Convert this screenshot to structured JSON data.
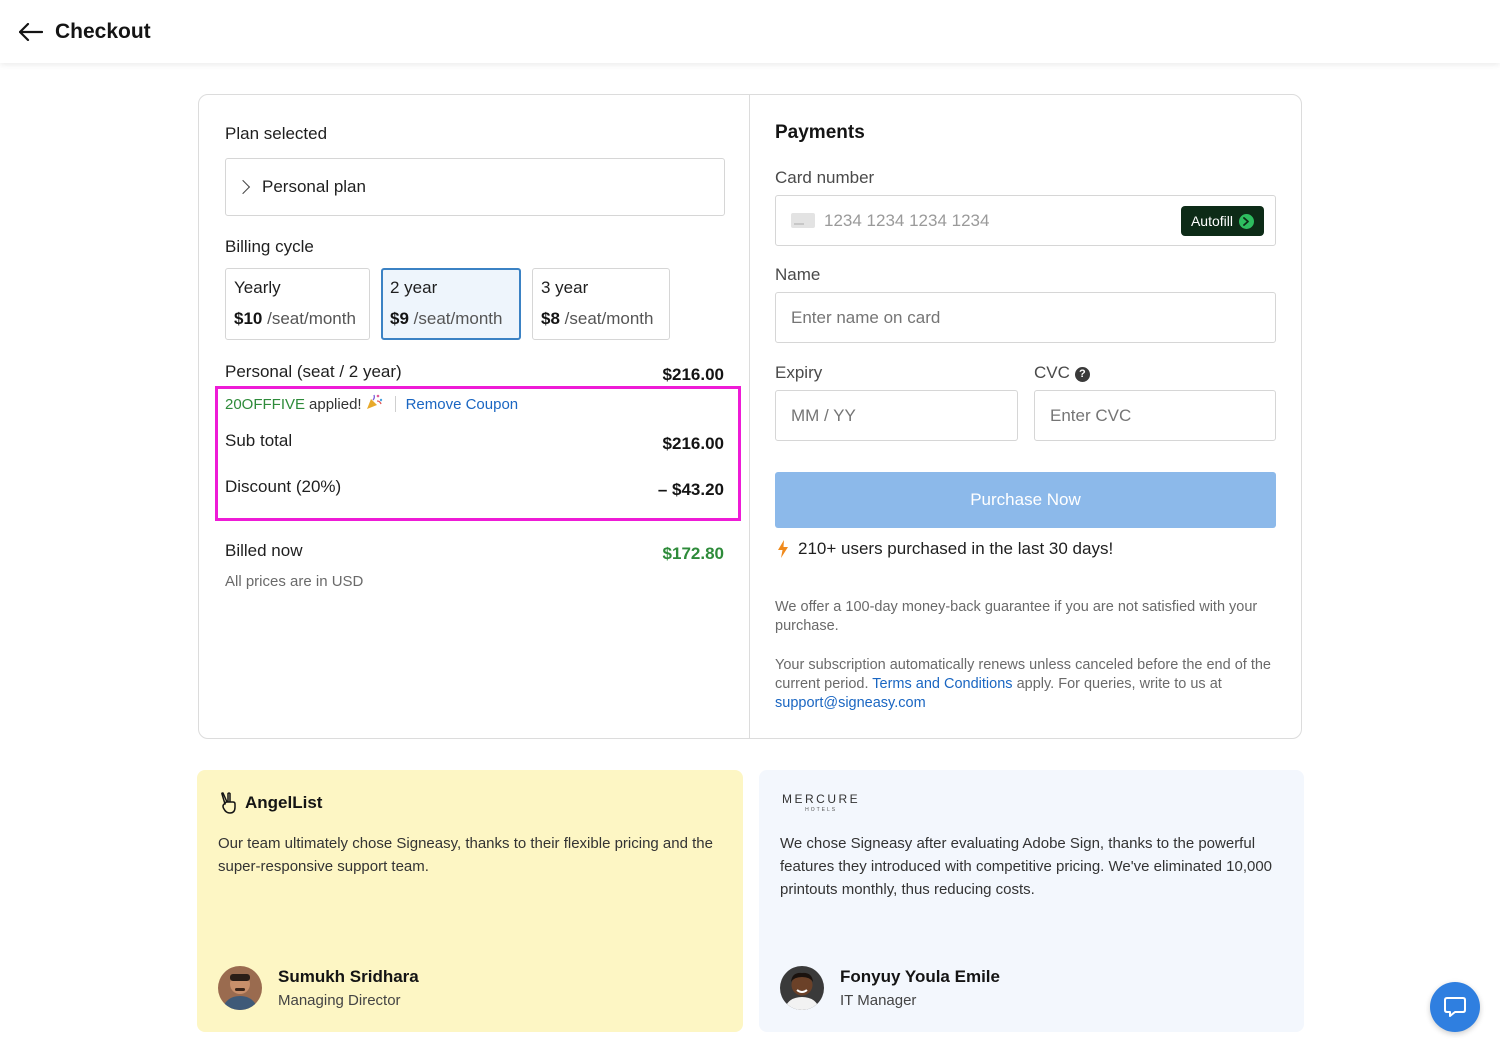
{
  "header": {
    "title": "Checkout"
  },
  "plan": {
    "section_label": "Plan selected",
    "selected_plan": "Personal plan",
    "billing_label": "Billing cycle",
    "cycles": [
      {
        "name": "Yearly",
        "price": "$10",
        "unit": "/seat/month",
        "selected": false
      },
      {
        "name": "2 year",
        "price": "$9",
        "unit": "/seat/month",
        "selected": true
      },
      {
        "name": "3 year",
        "price": "$8",
        "unit": "/seat/month",
        "selected": false
      }
    ]
  },
  "summary": {
    "line_item_label": "Personal (seat / 2 year)",
    "line_item_amount": "$216.00",
    "coupon_code": "20OFFFIVE",
    "coupon_applied_text": "applied!",
    "remove_coupon": "Remove Coupon",
    "subtotal_label": "Sub total",
    "subtotal_amount": "$216.00",
    "discount_label": "Discount (20%)",
    "discount_amount": "– $43.20",
    "billed_now_label": "Billed now",
    "billed_now_amount": "$172.80",
    "currency_note": "All prices are in USD"
  },
  "payment": {
    "title": "Payments",
    "card_number_label": "Card number",
    "card_number_placeholder": "1234 1234 1234 1234",
    "autofill_label": "Autofill",
    "name_label": "Name",
    "name_placeholder": "Enter name on card",
    "expiry_label": "Expiry",
    "expiry_placeholder": "MM / YY",
    "cvc_label": "CVC",
    "cvc_placeholder": "Enter CVC",
    "purchase_button": "Purchase Now",
    "social_proof": "210+ users purchased in the last 30 days!",
    "guarantee": "We offer a 100-day money-back guarantee if you are not satisfied with your purchase.",
    "renewal_prefix": "Your subscription automatically renews unless canceled before the end of the current period.",
    "terms_link": "Terms and Conditions",
    "renewal_middle": "apply. For queries, write to us at",
    "support_email": "support@signeasy.com"
  },
  "testimonials": [
    {
      "brand": "AngelList",
      "quote": "Our team ultimately chose Signeasy, thanks to their flexible pricing and the super-responsive support team.",
      "name": "Sumukh Sridhara",
      "role": "Managing Director"
    },
    {
      "brand": "MERCURE",
      "brand_sub": "HOTELS",
      "quote": "We chose Signeasy after evaluating Adobe Sign, thanks to the powerful features they introduced with competitive pricing. We've eliminated 10,000 printouts monthly, thus reducing costs.",
      "name": "Fonyuy Youla Emile",
      "role": "IT Manager"
    }
  ],
  "colors": {
    "accent_blue": "#3b82c4",
    "link_blue": "#1a66c2",
    "success_green": "#2e8b3a",
    "purchase_button": "#8cb9ea",
    "highlight_magenta": "#ee1bd6",
    "testimonial_yellow": "#fdf6c4",
    "testimonial_blue": "#f3f7fd"
  }
}
